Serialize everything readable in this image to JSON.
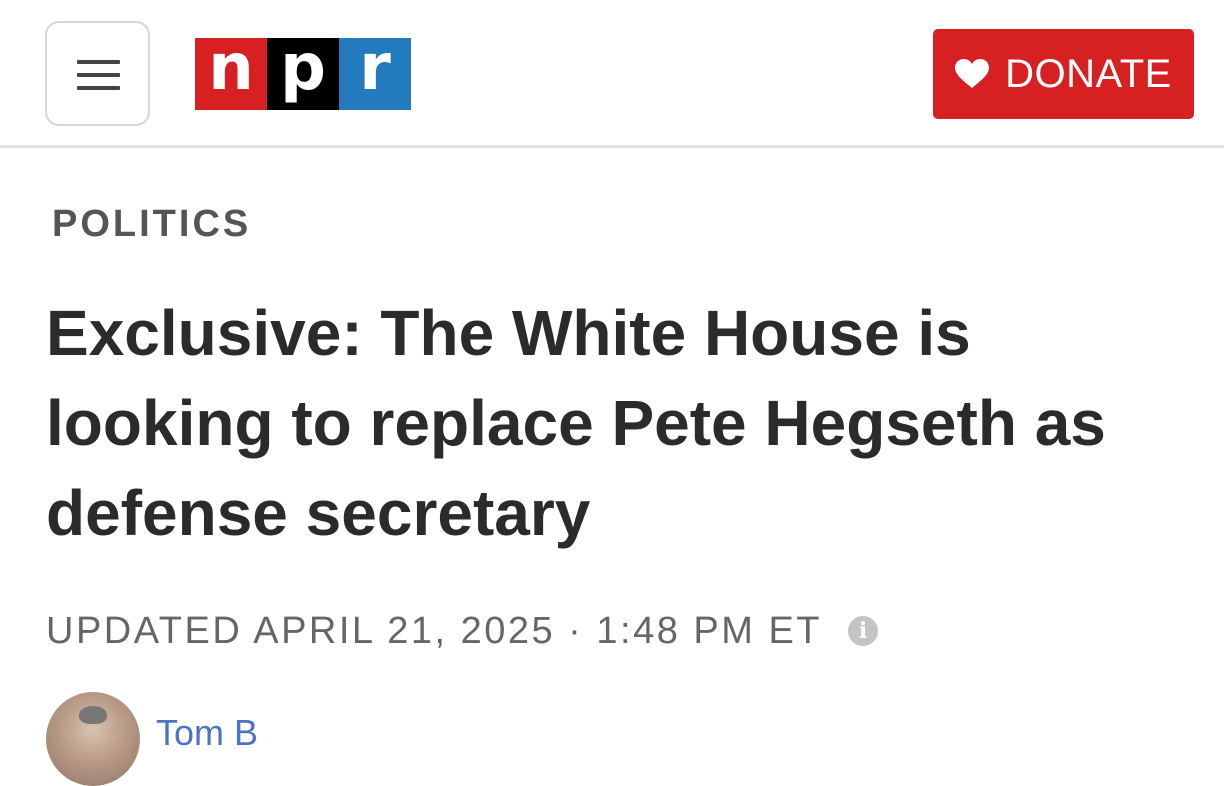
{
  "header": {
    "logo": {
      "letters": [
        "n",
        "p",
        "r"
      ],
      "colors": [
        "#d62021",
        "#000000",
        "#237bbd"
      ]
    },
    "menu_icon": "hamburger-menu-icon",
    "donate": {
      "label": "DONATE",
      "icon": "heart-icon",
      "color": "#d62021"
    }
  },
  "article": {
    "section": "POLITICS",
    "headline": "Exclusive: The White House is looking to replace Pete Hegseth as defense secretary",
    "dateline": "UPDATED APRIL 21, 2025 · 1:48 PM ET",
    "info_icon": "info-icon",
    "byline": {
      "author": "Tom B"
    }
  }
}
